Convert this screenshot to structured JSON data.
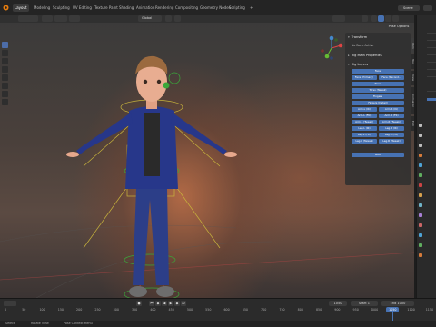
{
  "topbar": {
    "tabs": [
      {
        "label": "Layout",
        "active": true
      },
      {
        "label": "Modeling"
      },
      {
        "label": "Sculpting"
      },
      {
        "label": "UV Editing"
      },
      {
        "label": "Texture Paint"
      },
      {
        "label": "Shading"
      },
      {
        "label": "Animation"
      },
      {
        "label": "Rendering"
      },
      {
        "label": "Compositing"
      },
      {
        "label": "Geometry Nodes"
      },
      {
        "label": "Scripting"
      },
      {
        "label": "+"
      }
    ],
    "scene": "Scene"
  },
  "viewport": {
    "orientation": "Global",
    "pose_options": "Pose Options"
  },
  "npanel": {
    "transform": "Transform",
    "no_bone_active": "No Bone Active",
    "rig_main_properties": "Rig Main Properties",
    "rig_layers": "Rig Layers",
    "layer_buttons": [
      [
        "Face"
      ],
      [
        "Face (Primary)",
        "Face (Second..."
      ],
      [
        "Torso"
      ],
      [
        "Torso (Tweak)"
      ],
      [
        "Fingers"
      ],
      [
        "Fingers (Detail)"
      ],
      [
        "Arm.L (IK)",
        "Arm.R (IK)"
      ],
      [
        "Arm.L (FK)",
        "Arm.R (FK)"
      ],
      [
        "Arm.L (Tweak)",
        "Arm.R (Tweak)"
      ],
      [
        "Leg.L (IK)",
        "Leg.R (IK)"
      ],
      [
        "Leg.L (FK)",
        "Leg.R (FK)"
      ],
      [
        "Leg.L (Tweak)",
        "Leg.R (Tweak)"
      ],
      [
        "Root"
      ]
    ],
    "side_tabs": [
      "Item",
      "Tool",
      "View",
      "Animation",
      "Edit"
    ]
  },
  "timeline": {
    "start_label": "Start",
    "start_value": "1",
    "end_label": "End",
    "end_value": "1000",
    "current_frame": "1050",
    "current_frame_field": "1050",
    "ruler_ticks": [
      "0",
      "50",
      "100",
      "150",
      "200",
      "250",
      "300",
      "350",
      "400",
      "450",
      "500",
      "550",
      "600",
      "650",
      "700",
      "750",
      "800",
      "850",
      "900",
      "950",
      "1000",
      "1050",
      "1100",
      "1150"
    ]
  },
  "status": {
    "left": "Select",
    "middle": "Rotate View",
    "right": "Pose Context Menu"
  },
  "colors": {
    "accent": "#4772b3",
    "topbar": "#242424",
    "panel": "#303030"
  }
}
